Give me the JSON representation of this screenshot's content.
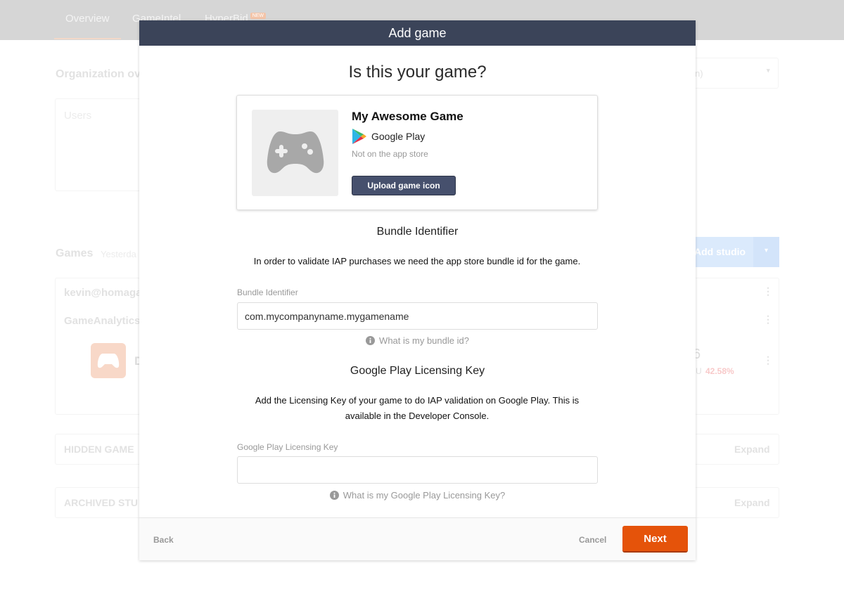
{
  "background": {
    "tabs": [
      {
        "label": "Overview"
      },
      {
        "label": "GameIntel"
      },
      {
        "label": "HyperBid",
        "badge": "NEW"
      }
    ],
    "org_title": "Organization ov",
    "users_label": "Users",
    "date_select": "n)",
    "games_title": "Games",
    "games_sub": "Yesterda",
    "rows": [
      "kevin@homaga",
      "GameAnalytics"
    ],
    "game_initial": "D",
    "metric_value": "6",
    "metric_label": "U",
    "metric_change": "42.58%",
    "add_studio": "Add studio",
    "hidden_games": "HIDDEN GAME",
    "archived": "ARCHIVED STU",
    "expand": "Expand"
  },
  "modal": {
    "header": "Add game",
    "title": "Is this your game?",
    "game": {
      "name": "My Awesome Game",
      "store": "Google Play",
      "status": "Not on the app store",
      "upload_label": "Upload game icon"
    },
    "bundle": {
      "section_title": "Bundle Identifier",
      "description": "In order to validate IAP purchases we need the app store bundle id for the game.",
      "label": "Bundle Identifier",
      "value": "com.mycompanyname.mygamename",
      "help": "What is my bundle id?"
    },
    "licensing": {
      "section_title": "Google Play Licensing Key",
      "description": "Add the Licensing Key of your game to do IAP validation on Google Play. This is available in the Developer Console.",
      "label": "Google Play Licensing Key",
      "value": "",
      "help": "What is my Google Play Licensing Key?"
    },
    "footer": {
      "back": "Back",
      "cancel": "Cancel",
      "next": "Next"
    }
  },
  "colors": {
    "header": "#3b4459",
    "accent": "#e5530a",
    "upload": "#46506d"
  }
}
